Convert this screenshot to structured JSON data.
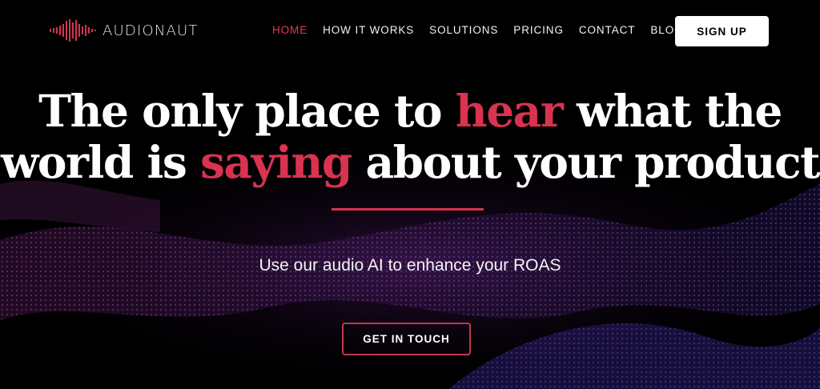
{
  "brand": {
    "name": "AUDIONAUT",
    "accent": "#d8334f"
  },
  "nav": {
    "items": [
      {
        "label": "HOME",
        "active": true
      },
      {
        "label": "HOW IT WORKS"
      },
      {
        "label": "SOLUTIONS"
      },
      {
        "label": "PRICING"
      },
      {
        "label": "CONTACT"
      },
      {
        "label": "BLOG"
      }
    ],
    "signup_label": "SIGN UP"
  },
  "hero": {
    "title_part1": "The only place to ",
    "title_hl1": "hear",
    "title_part2": " what the world is ",
    "title_hl2": "saying",
    "title_part3": " about your product",
    "subtitle": "Use our audio AI to enhance your ROAS",
    "cta_label": "GET IN TOUCH"
  },
  "icons": {
    "logo": "sound-wave-logo-icon"
  }
}
